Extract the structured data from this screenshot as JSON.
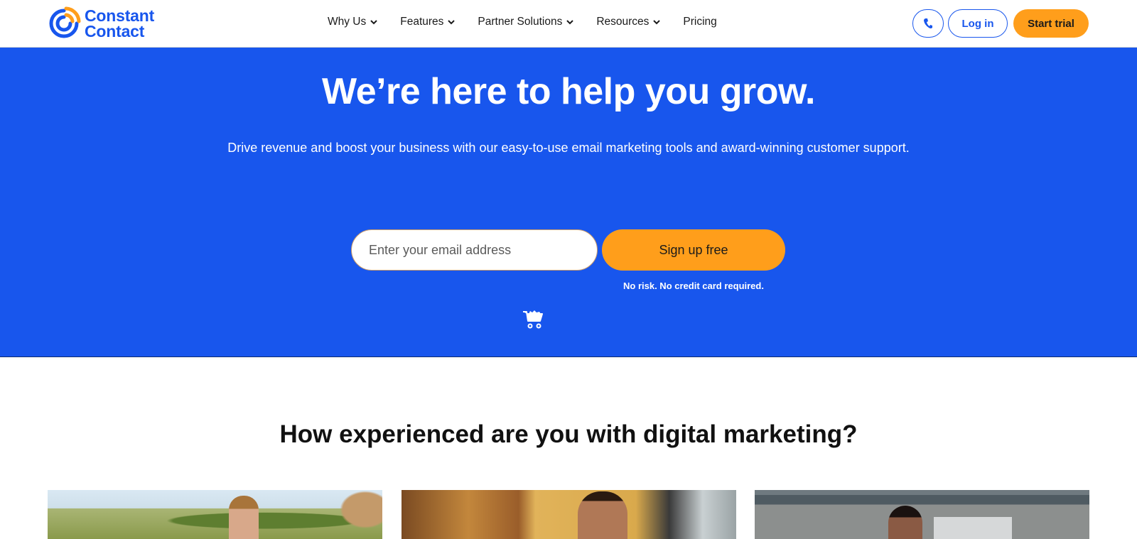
{
  "brand": {
    "name_line1": "Constant",
    "name_line2": "Contact",
    "primary_color": "#1856ed",
    "accent_color": "#ff9e1b"
  },
  "nav": {
    "items": [
      {
        "label": "Why Us",
        "has_dropdown": true
      },
      {
        "label": "Features",
        "has_dropdown": true
      },
      {
        "label": "Partner Solutions",
        "has_dropdown": true
      },
      {
        "label": "Resources",
        "has_dropdown": true
      },
      {
        "label": "Pricing",
        "has_dropdown": false
      }
    ],
    "phone_icon": "phone-icon",
    "login_label": "Log in",
    "trial_label": "Start trial"
  },
  "hero": {
    "title": "We’re here to help you grow.",
    "subtitle": "Drive revenue and boost your business with our easy-to-use email marketing tools and award-winning customer support.",
    "email_placeholder": "Enter your email address",
    "email_value": "",
    "signup_label": "Sign up free",
    "disclaimer": "No risk. No credit card required.",
    "cart_icon": "shopping-cart-icon"
  },
  "section": {
    "title": "How experienced are you with digital marketing?",
    "cards": [
      {
        "image": "man-in-cap-outdoors-with-dog"
      },
      {
        "image": "man-working-in-cafe"
      },
      {
        "image": "woman-at-laptop-in-office"
      }
    ]
  }
}
